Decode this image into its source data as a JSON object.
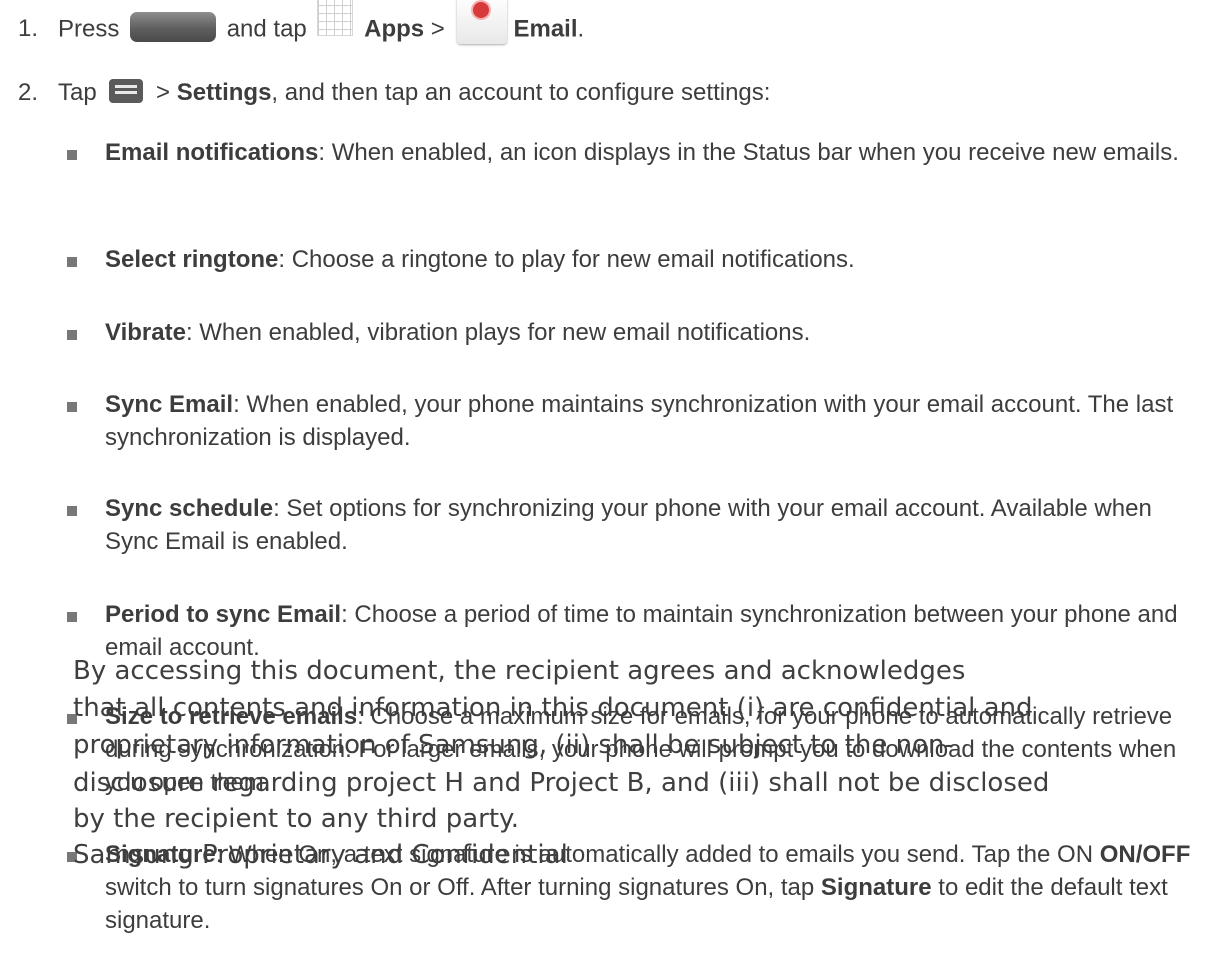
{
  "steps": [
    {
      "num": "1.",
      "t1": "Press",
      "t2": "and tap",
      "apps": "Apps",
      "sep": ">",
      "email": "Email",
      "end": "."
    },
    {
      "num": "2.",
      "tap": "Tap",
      "sep": ">",
      "settings": "Settings",
      "rest": ", and then tap an account to configure settings:"
    }
  ],
  "bullets": [
    {
      "term": "Email notifications",
      "desc": ": When enabled, an icon displays in the Status bar when you receive new emails."
    },
    {
      "term": "Select ringtone",
      "desc": ": Choose a ringtone to play for new email notifications."
    },
    {
      "term": "Vibrate",
      "desc": ": When enabled, vibration plays for new email notifications."
    },
    {
      "term": "Sync Email",
      "desc": ": When enabled, your phone maintains synchronization with your email account. The last synchronization is displayed."
    },
    {
      "term": "Sync schedule",
      "desc": ": Set options for synchronizing your phone with your email account. Available when Sync Email is enabled."
    },
    {
      "term": "Period to sync Email",
      "desc": ": Choose a period of time to maintain synchronization between your phone and email account."
    },
    {
      "term": "Size to retrieve emails",
      "desc": ": Choose a maximum size for emails, for your phone to automatically retrieve during synchronization. For larger emails, your phone will prompt you to download the contents when you open them."
    },
    {
      "term": "Signature",
      "desc": ": When On, a text signature is automatically added to emails you send. Tap the ON ",
      "term2": "ON/OFF",
      "desc2": " switch to turn signatures On or Off. After turning signatures On, tap ",
      "term3": "Signature",
      "desc3": " to edit the default text signature."
    }
  ],
  "watermark": [
    "By accessing this document, the recipient agrees and acknowledges",
    "that all contents and information in this document (i) are confidential and",
    "proprietary information of Samsung, (ii) shall be subject to the non-",
    "disclosure regarding project H and Project B, and (iii) shall not be disclosed",
    "by the recipient to any third party.",
    "Samsung Proprietary and Confidential"
  ],
  "icons": [
    "home-key-icon",
    "apps-icon",
    "email-app-icon",
    "menu-icon"
  ]
}
